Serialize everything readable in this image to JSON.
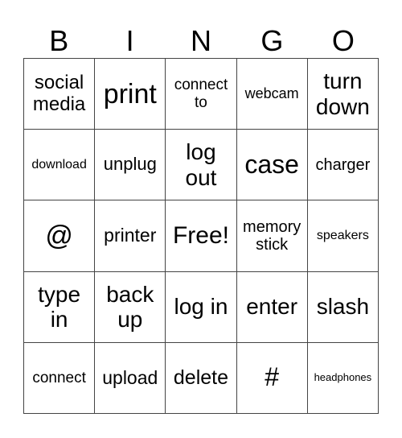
{
  "header": [
    "B",
    "I",
    "N",
    "G",
    "O"
  ],
  "rows": [
    [
      {
        "text": "social media",
        "size": 24
      },
      {
        "text": "print",
        "size": 34
      },
      {
        "text": "connect to",
        "size": 19
      },
      {
        "text": "webcam",
        "size": 18
      },
      {
        "text": "turn down",
        "size": 28
      }
    ],
    [
      {
        "text": "download",
        "size": 16
      },
      {
        "text": "unplug",
        "size": 22
      },
      {
        "text": "log out",
        "size": 28
      },
      {
        "text": "case",
        "size": 32
      },
      {
        "text": "charger",
        "size": 20
      }
    ],
    [
      {
        "text": "@",
        "size": 34
      },
      {
        "text": "printer",
        "size": 23
      },
      {
        "text": "Free!",
        "size": 30
      },
      {
        "text": "memory stick",
        "size": 20
      },
      {
        "text": "speakers",
        "size": 16
      }
    ],
    [
      {
        "text": "type in",
        "size": 28
      },
      {
        "text": "back up",
        "size": 28
      },
      {
        "text": "log in",
        "size": 28
      },
      {
        "text": "enter",
        "size": 28
      },
      {
        "text": "slash",
        "size": 28
      }
    ],
    [
      {
        "text": "connect",
        "size": 19
      },
      {
        "text": "upload",
        "size": 23
      },
      {
        "text": "delete",
        "size": 25
      },
      {
        "text": "#",
        "size": 32
      },
      {
        "text": "headphones",
        "size": 13
      }
    ]
  ]
}
